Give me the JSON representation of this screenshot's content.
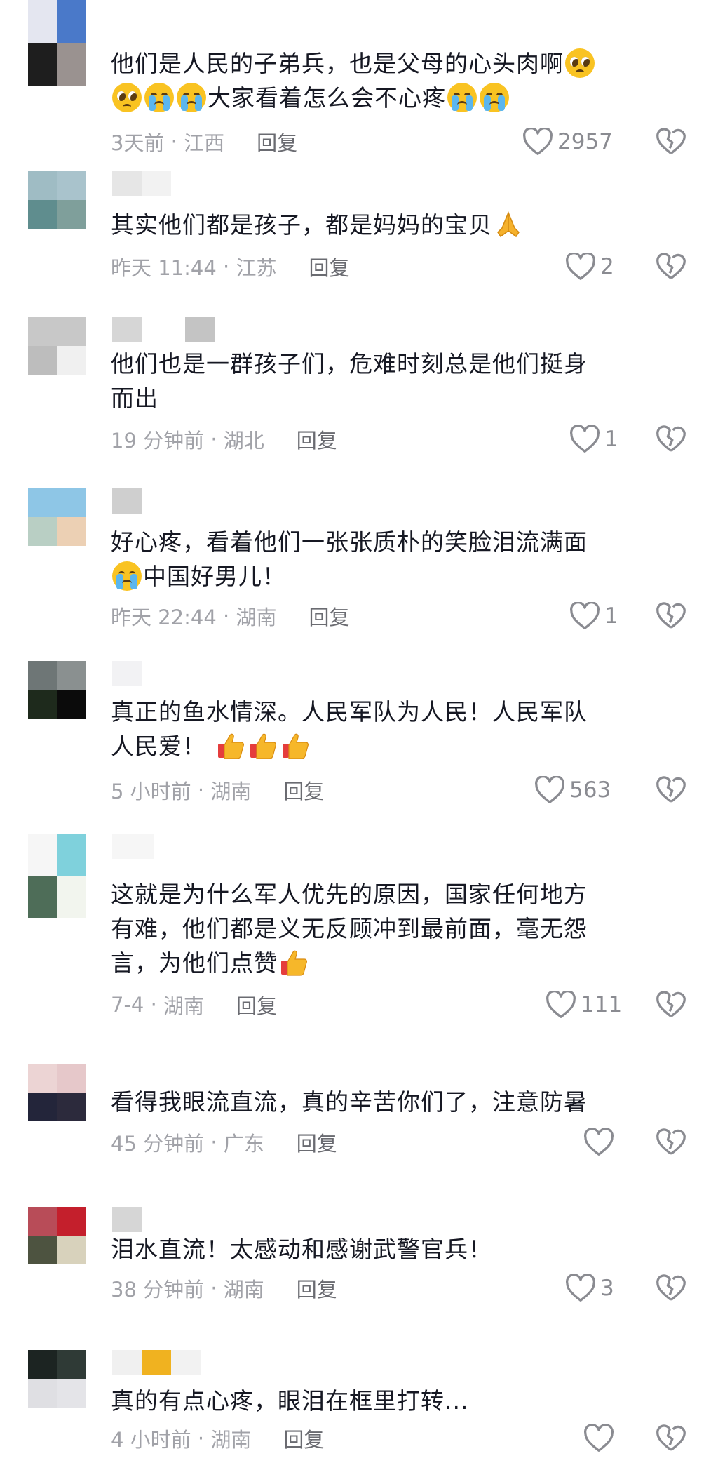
{
  "comments": [
    {
      "avatar_colors": [
        "#e4e6f0",
        "#4a79c9",
        "#1e1e1e",
        "#9a9290"
      ],
      "name_blocks": [],
      "lines": [
        "他们是人民的子弟兵，也是父母的心头肉啊",
        "大家看着怎么会不心疼"
      ],
      "time": "3天前",
      "location": "江西",
      "reply": "回复",
      "likes": "2957"
    },
    {
      "avatar_colors": [
        "#9fbcc4",
        "#a9c3cc",
        "#5f8d8e",
        "#7f9f9b"
      ],
      "name_blocks": [],
      "lines": [
        "其实他们都是孩子，都是妈妈的宝贝"
      ],
      "time": "昨天 11:44",
      "location": "江苏",
      "reply": "回复",
      "likes": "2"
    },
    {
      "avatar_colors": [
        "#c8c8c8",
        "#c8c8c8",
        "#bdbdbd",
        "#f0f0f0"
      ],
      "name_blocks": [],
      "lines": [
        "他们也是一群孩子们，危难时刻总是他们挺身",
        "而出"
      ],
      "time": "19 分钟前",
      "location": "湖北",
      "reply": "回复",
      "likes": "1"
    },
    {
      "avatar_colors": [
        "#8ec6e6",
        "#8ec6e6",
        "#b9cfc4",
        "#ecd0b4"
      ],
      "name_blocks": [],
      "lines": [
        "好心疼，看着他们一张张质朴的笑脸泪流满面",
        "中国好男儿！"
      ],
      "time": "昨天 22:44",
      "location": "湖南",
      "reply": "回复",
      "likes": "1"
    },
    {
      "avatar_colors": [
        "#6e7676",
        "#8a9090",
        "#1e2a1c",
        "#0b0b0b"
      ],
      "name_blocks": [],
      "lines": [
        "真正的鱼水情深。人民军队为人民！人民军队",
        "人民爱！"
      ],
      "time": "5 小时前",
      "location": "湖南",
      "reply": "回复",
      "likes": "563"
    },
    {
      "avatar_colors": [
        "#f6f6f6",
        "#7fd1dc",
        "#4e6d58",
        "#f2f5ee"
      ],
      "name_blocks": [],
      "lines": [
        "这就是为什么军人优先的原因，国家任何地方",
        "有难，他们都是义无反顾冲到最前面，毫无怨",
        "言，为他们点赞"
      ],
      "time": "7-4",
      "location": "湖南",
      "reply": "回复",
      "likes": "111"
    },
    {
      "avatar_colors": [
        "#ecd4d4",
        "#e6c8ca",
        "#23253a",
        "#2c2a3c"
      ],
      "name_blocks": [],
      "lines": [
        "看得我眼流直流，真的辛苦你们了，注意防暑"
      ],
      "time": "45 分钟前",
      "location": "广东",
      "reply": "回复",
      "likes": ""
    },
    {
      "avatar_colors": [
        "#b84c58",
        "#c41f2c",
        "#4d5340",
        "#d8d2bc"
      ],
      "name_blocks": [],
      "lines": [
        "泪水直流！太感动和感谢武警官兵！"
      ],
      "time": "38 分钟前",
      "location": "湖南",
      "reply": "回复",
      "likes": "3"
    },
    {
      "avatar_colors": [
        "#1c2422",
        "#2f3a36",
        "#dfdfe3",
        "#e4e4e8"
      ],
      "name_blocks": [],
      "lines": [
        "真的有点心疼，眼泪在框里打转..."
      ],
      "time": "4 小时前",
      "location": "湖南",
      "reply": "回复",
      "likes": ""
    }
  ],
  "icons": {
    "like": "heart-outline-icon",
    "dislike": "broken-heart-icon"
  },
  "colors": {
    "text": "#161823",
    "meta": "#a1a2a8",
    "reply": "#6a6b71",
    "icon": "#8a8b91"
  }
}
